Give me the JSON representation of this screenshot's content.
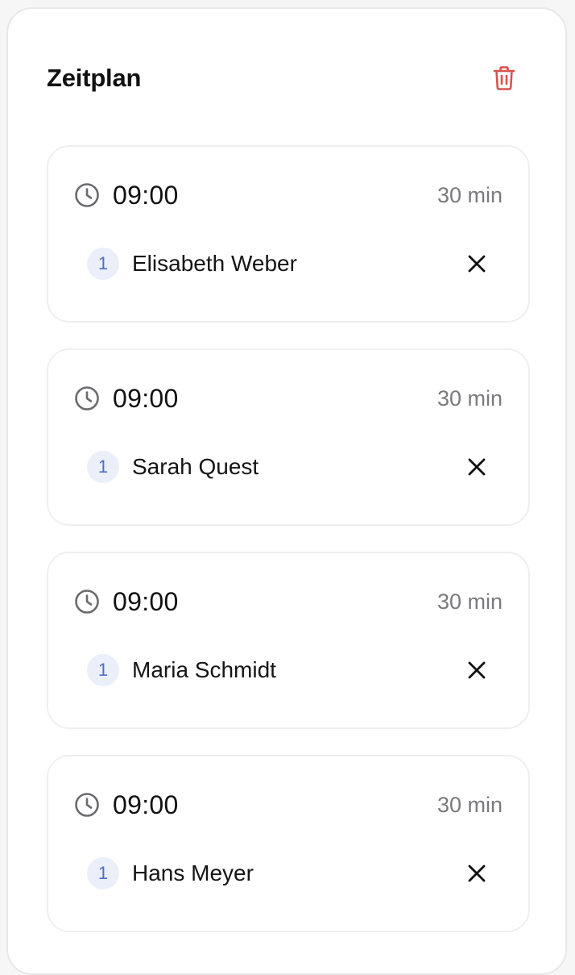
{
  "schedule": {
    "title": "Zeitplan",
    "delete_icon": "trash-icon",
    "slots": [
      {
        "time": "09:00",
        "duration": "30 min",
        "participant": {
          "order": "1",
          "name": "Elisabeth Weber"
        }
      },
      {
        "time": "09:00",
        "duration": "30 min",
        "participant": {
          "order": "1",
          "name": "Sarah Quest"
        }
      },
      {
        "time": "09:00",
        "duration": "30 min",
        "participant": {
          "order": "1",
          "name": "Maria Schmidt"
        }
      },
      {
        "time": "09:00",
        "duration": "30 min",
        "participant": {
          "order": "1",
          "name": "Hans Meyer"
        }
      }
    ]
  },
  "colors": {
    "danger": "#d9534f",
    "badge_bg": "#eaeff9",
    "badge_text": "#4d6fc6",
    "muted": "#7a7a7e"
  }
}
